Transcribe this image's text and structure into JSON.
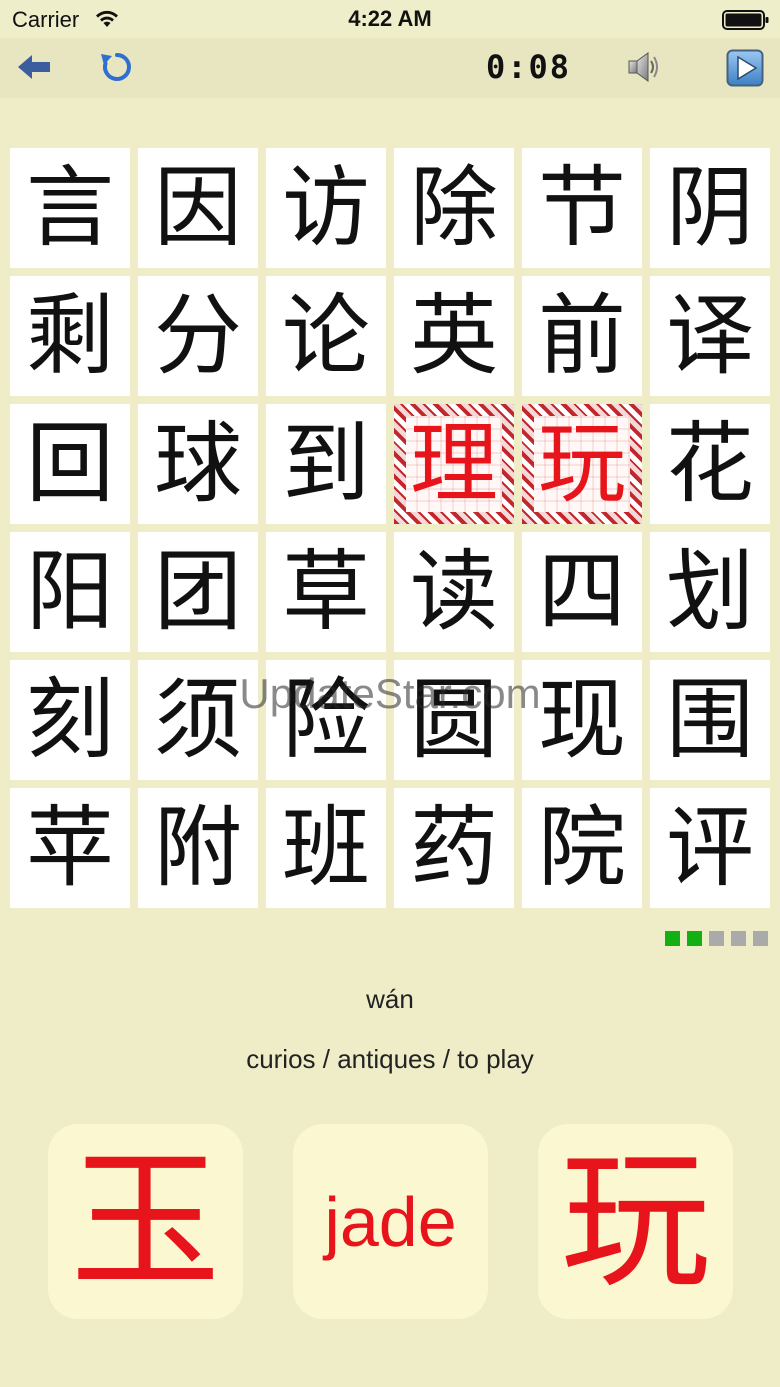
{
  "status_bar": {
    "carrier": "Carrier",
    "time": "4:22 AM"
  },
  "toolbar": {
    "timer": "0:08"
  },
  "grid": {
    "rows": [
      [
        "言",
        "因",
        "访",
        "除",
        "节",
        "阴"
      ],
      [
        "剩",
        "分",
        "论",
        "英",
        "前",
        "译"
      ],
      [
        "回",
        "球",
        "到",
        "理",
        "玩",
        "花"
      ],
      [
        "阳",
        "团",
        "草",
        "读",
        "四",
        "划"
      ],
      [
        "刻",
        "须",
        "险",
        "圆",
        "现",
        "围"
      ],
      [
        "苹",
        "附",
        "班",
        "药",
        "院",
        "评"
      ]
    ],
    "selected": [
      [
        2,
        3
      ],
      [
        2,
        4
      ]
    ]
  },
  "watermark": "UpdateStar.com",
  "progress": {
    "total": 5,
    "completed": 2,
    "done_color": "#12B012",
    "pending_color": "#AAAAAA"
  },
  "prompt": {
    "pinyin": "wán",
    "meaning": "curios / antiques / to play"
  },
  "answers": [
    {
      "label": "玉",
      "kind": "glyph"
    },
    {
      "label": "jade",
      "kind": "word"
    },
    {
      "label": "玩",
      "kind": "glyph"
    }
  ],
  "colors": {
    "background": "#EEEDC8",
    "accent_red": "#E8141B",
    "back_arrow": "#3C5E9E",
    "refresh": "#2E6FD1"
  }
}
